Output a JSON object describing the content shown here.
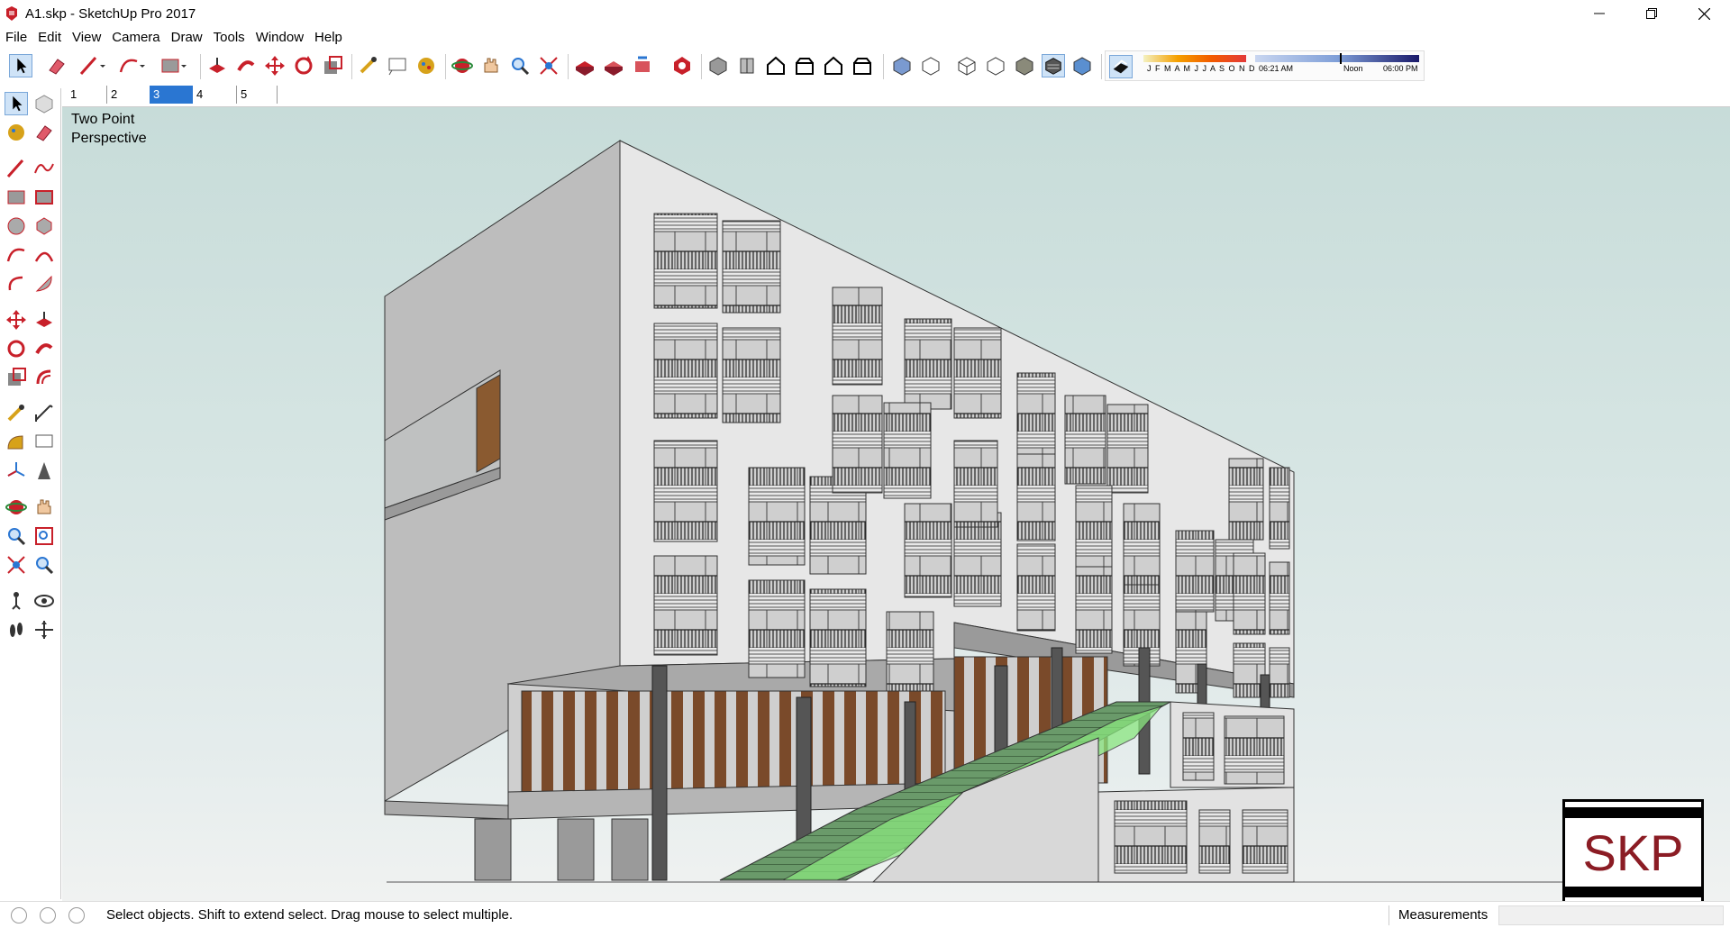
{
  "window": {
    "title": "A1.skp - SketchUp Pro 2017",
    "minimize": "—",
    "maximize": "❐",
    "close": "✕"
  },
  "menu": [
    "File",
    "Edit",
    "View",
    "Camera",
    "Draw",
    "Tools",
    "Window",
    "Help"
  ],
  "scene_tabs": [
    {
      "label": "1",
      "active": false
    },
    {
      "label": "2",
      "active": false
    },
    {
      "label": "3",
      "active": true
    },
    {
      "label": "4",
      "active": false
    },
    {
      "label": "5",
      "active": false
    }
  ],
  "shadow_panel": {
    "months": "J F M A M J J A S O N D",
    "time_start": "06:21 AM",
    "time_mid": "Noon",
    "time_end": "06:00 PM"
  },
  "viewport": {
    "camera_label_line1": "Two Point",
    "camera_label_line2": "Perspective"
  },
  "badge": {
    "text": "SKP"
  },
  "status": {
    "message": "Select objects. Shift to extend select. Drag mouse to select multiple.",
    "measurements_label": "Measurements",
    "measurements_value": ""
  },
  "colors": {
    "accent": "#2a76d2",
    "sketchup_red": "#c8202a",
    "sky_top": "#c7dcd9",
    "ground": "#f0f2f1"
  }
}
